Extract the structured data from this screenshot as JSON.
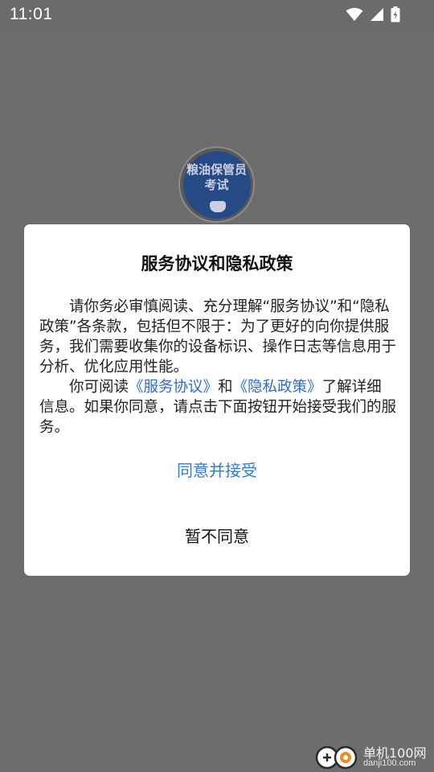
{
  "status_bar": {
    "time": "11:01",
    "icons": [
      "wifi-icon",
      "signal-icon",
      "battery-charging-icon"
    ]
  },
  "app_logo": {
    "text_line1": "粮油保管员",
    "text_line2": "考试"
  },
  "dialog": {
    "title": "服务协议和隐私政策",
    "paragraph1": "请你务必审慎阅读、充分理解“服务协议”和“隐私政策”各条款，包括但不限于：为了更好的向你提供服务，我们需要收集你的设备标识、操作日志等信息用于分析、优化应用性能。",
    "paragraph2_prefix": "你可阅读",
    "service_agreement_link": "《服务协议》",
    "paragraph2_and": "和",
    "privacy_policy_link": "《隐私政策》",
    "paragraph2_suffix": "了解详细信息。如果你同意，请点击下面按钮开始接受我们的服务。",
    "agree_label": "同意并接受",
    "disagree_label": "暂不同意",
    "link_color": "#2f6bd1",
    "agree_color": "#2f7bd8"
  },
  "watermark": {
    "name": "单机100网",
    "url": "danji100.com"
  }
}
